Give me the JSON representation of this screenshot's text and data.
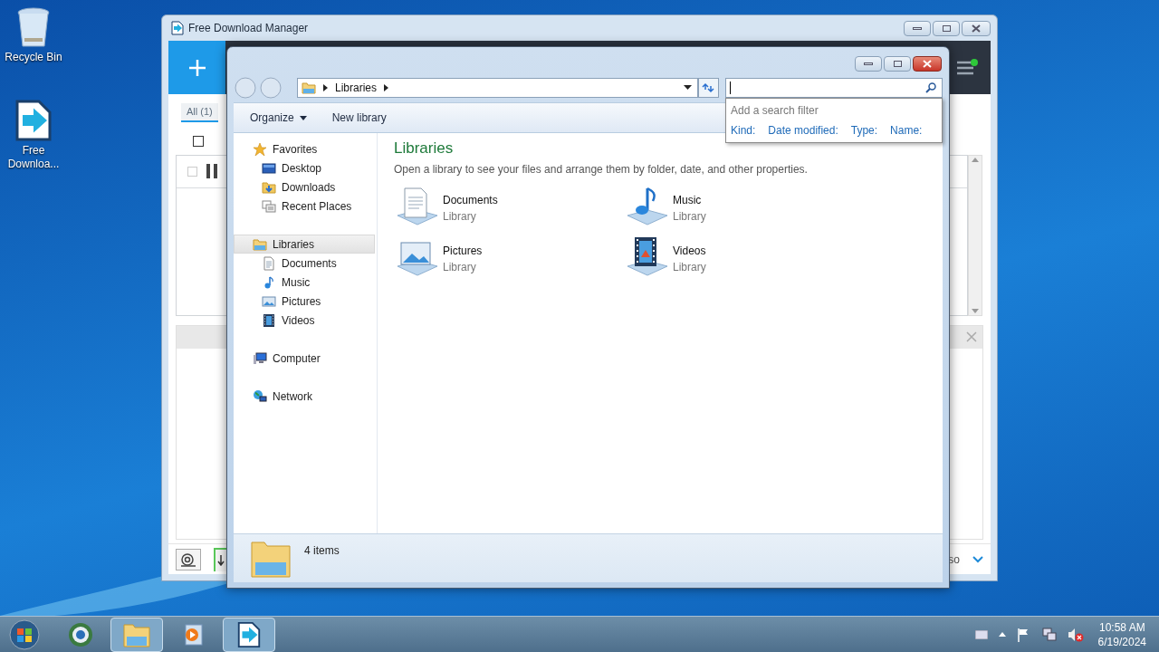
{
  "desktop_icons": [
    {
      "label": "Recycle Bin",
      "kind": "recycle-bin"
    },
    {
      "label": "Free Downloa...",
      "kind": "fdm"
    }
  ],
  "fdm_window": {
    "title": "Free Download Manager",
    "tabs": [
      {
        "label": "All (1)",
        "selected": true
      }
    ],
    "select_all_checked": false,
    "rows": [
      {
        "checked": false
      }
    ],
    "bottom_text": "so"
  },
  "explorer": {
    "address": [
      "Libraries"
    ],
    "search": {
      "filter_hint": "Add a search filter",
      "filters": [
        "Kind:",
        "Date modified:",
        "Type:",
        "Name:"
      ]
    },
    "toolbar": [
      {
        "label": "Organize",
        "has_menu": true
      },
      {
        "label": "New library",
        "has_menu": false
      }
    ],
    "nav": [
      {
        "label": "Favorites",
        "kind": "star",
        "selected": false,
        "children": [
          {
            "label": "Desktop",
            "kind": "desktop",
            "selected": false
          },
          {
            "label": "Downloads",
            "kind": "downloads",
            "selected": false
          },
          {
            "label": "Recent Places",
            "kind": "recent",
            "selected": false
          }
        ]
      },
      {
        "label": "Libraries",
        "kind": "libraries",
        "selected": true,
        "children": [
          {
            "label": "Documents",
            "kind": "documents",
            "selected": false
          },
          {
            "label": "Music",
            "kind": "music",
            "selected": false
          },
          {
            "label": "Pictures",
            "kind": "pictures",
            "selected": false
          },
          {
            "label": "Videos",
            "kind": "videos",
            "selected": false
          }
        ]
      },
      {
        "label": "Computer",
        "kind": "computer",
        "selected": false
      },
      {
        "label": "Network",
        "kind": "network",
        "selected": false
      }
    ],
    "heading": "Libraries",
    "subtitle": "Open a library to see your files and arrange them by folder, date, and other properties.",
    "libraries": [
      {
        "name": "Documents",
        "type": "Library",
        "kind": "documents"
      },
      {
        "name": "Music",
        "type": "Library",
        "kind": "music"
      },
      {
        "name": "Pictures",
        "type": "Library",
        "kind": "pictures"
      },
      {
        "name": "Videos",
        "type": "Library",
        "kind": "videos"
      }
    ],
    "status": "4 items"
  },
  "taskbar": {
    "apps": [
      {
        "kind": "browser",
        "active": false
      },
      {
        "kind": "explorer",
        "active": true
      },
      {
        "kind": "media",
        "active": false
      },
      {
        "kind": "fdm",
        "active": true
      }
    ],
    "clock": {
      "time": "10:58 AM",
      "date": "6/19/2024"
    }
  }
}
